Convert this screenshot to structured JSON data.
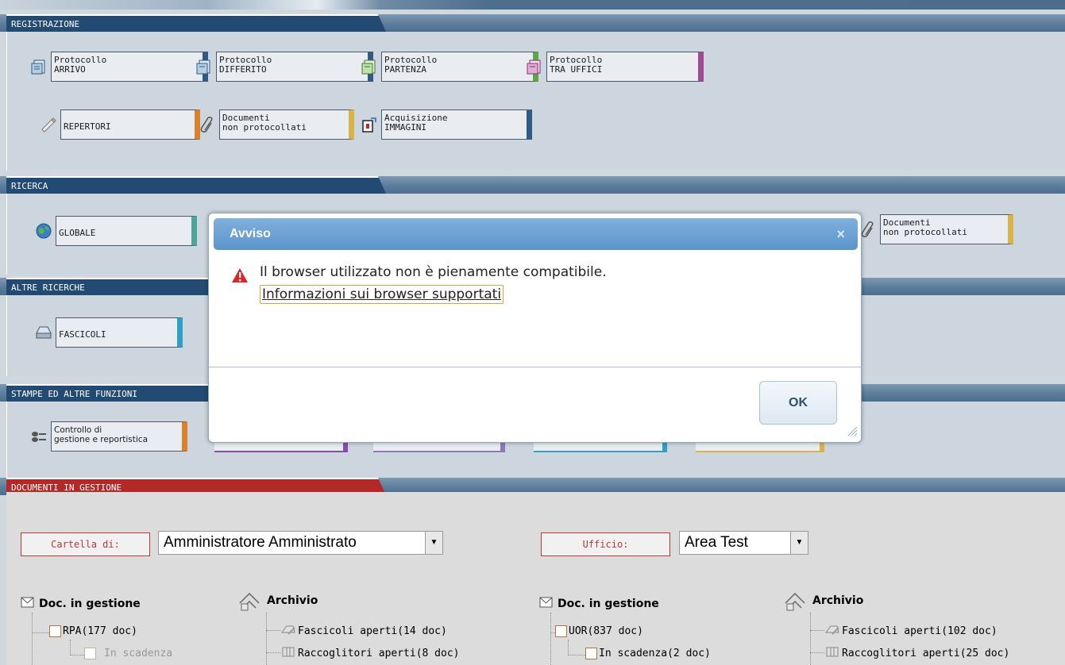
{
  "sections": {
    "registrazione": "REGISTRAZIONE",
    "ricerca": "RICERCA",
    "altre_ricerche": "ALTRE RICERCHE",
    "stampe": "STAMPE ED ALTRE FUNZIONI",
    "documenti": "DOCUMENTI IN GESTIONE"
  },
  "registrazione": {
    "arrivo": [
      "Protocollo",
      "ARRIVO"
    ],
    "differito": [
      "Protocollo",
      "DIFFERITO"
    ],
    "partenza": [
      "Protocollo",
      "PARTENZA"
    ],
    "tra_uffici": [
      "Protocollo",
      "TRA UFFICI"
    ],
    "repertori": "REPERTORI",
    "non_protocollati": [
      "Documenti",
      "non protocollati"
    ],
    "immagini": [
      "Acquisizione",
      "IMMAGINI"
    ]
  },
  "ricerca": {
    "globale": "GLOBALE",
    "non_protocollati": [
      "Documenti",
      "non protocollati"
    ]
  },
  "altre_ricerche": {
    "fascicoli": "FASCICOLI"
  },
  "stampe": {
    "controllo": [
      "Controllo di",
      "gestione e reportistica"
    ]
  },
  "documenti": {
    "cartella_label": "Cartella di:",
    "cartella_value": "Amministratore Amministrato",
    "ufficio_label": "Ufficio:",
    "ufficio_value": "Area Test",
    "col1": {
      "header": "Doc. in gestione",
      "item1": "RPA(177 doc)",
      "item2": "In scadenza"
    },
    "col2": {
      "header": "Archivio",
      "item1": "Fascicoli aperti(14 doc)",
      "item2": "Raccoglitori aperti(8 doc)"
    },
    "col3": {
      "header": "Doc. in gestione",
      "item1": "UOR(837 doc)",
      "item2": "In scadenza(2 doc)"
    },
    "col4": {
      "header": "Archivio",
      "item1": "Fascicoli aperti(102 doc)",
      "item2": "Raccoglitori aperti(25 doc)"
    }
  },
  "dialog": {
    "title": "Avviso",
    "close": "×",
    "message": "Il browser utilizzato non è pienamente compatibile.",
    "link": "Informazioni sui browser supportati",
    "ok": "OK"
  },
  "colors": {
    "arrivo": "#2f5a85",
    "differito": "#2f5a85",
    "partenza": "#5aa845",
    "tra_uffici": "#a04a96",
    "repertori": "#d9822b",
    "non_protocollati": "#d9b24a",
    "immagini": "#2f5a85",
    "globale": "#4aa59a",
    "fascicoli": "#2ea0c8"
  }
}
